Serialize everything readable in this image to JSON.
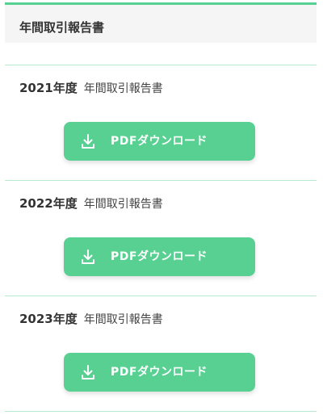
{
  "header": {
    "title": "年間取引報告書"
  },
  "reports": [
    {
      "year": "2021年度",
      "name": "年間取引報告書",
      "button_label": "PDFダウンロード",
      "button_icon": "download-icon"
    },
    {
      "year": "2022年度",
      "name": "年間取引報告書",
      "button_label": "PDFダウンロード",
      "button_icon": "download-icon"
    },
    {
      "year": "2023年度",
      "name": "年間取引報告書",
      "button_label": "PDFダウンロード",
      "button_icon": "download-icon"
    }
  ],
  "colors": {
    "accent": "#57d092",
    "header_background": "#f5f5f5",
    "divider": "#b8ead0",
    "button_text": "#ffffff"
  }
}
